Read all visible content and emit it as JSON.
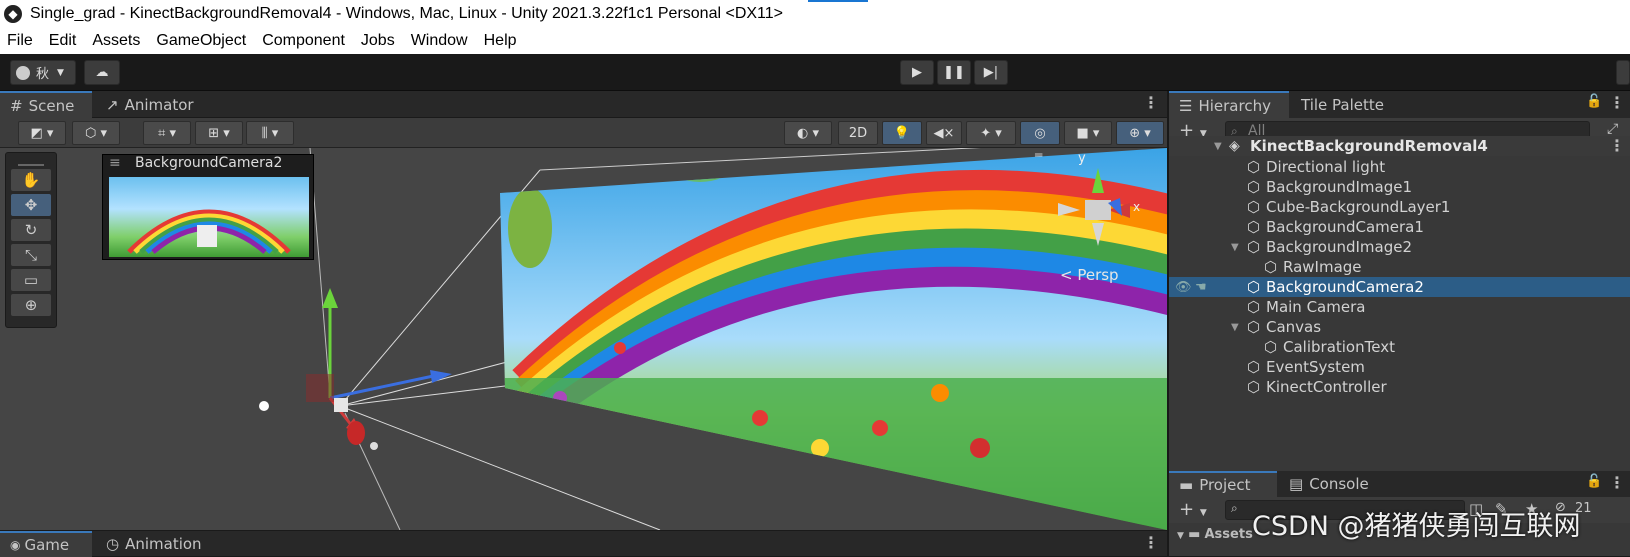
{
  "window": {
    "title": "Single_grad - KinectBackgroundRemoval4 - Windows, Mac, Linux - Unity 2021.3.22f1c1 Personal <DX11>"
  },
  "menu": [
    "File",
    "Edit",
    "Assets",
    "GameObject",
    "Component",
    "Jobs",
    "Window",
    "Help"
  ],
  "toolbar": {
    "account_label": "秋",
    "play_icon": "play-icon",
    "pause_icon": "pause-icon",
    "step_icon": "step-icon"
  },
  "scene_tabs": {
    "scene": "Scene",
    "animator": "Animator"
  },
  "scene_toolbar": {
    "mode_2d": "2D"
  },
  "viewport": {
    "camera_preview_title": "BackgroundCamera2",
    "gizmo_y": "y",
    "gizmo_x": "x",
    "persp_label": "< Persp"
  },
  "bottom_tabs": {
    "game": "Game",
    "animation": "Animation"
  },
  "hierarchy": {
    "tab_hierarchy": "Hierarchy",
    "tab_tile_palette": "Tile Palette",
    "search_placeholder": "All",
    "scene_name": "KinectBackgroundRemoval4",
    "items": [
      {
        "label": "Directional light",
        "depth": 1
      },
      {
        "label": "BackgroundImage1",
        "depth": 1
      },
      {
        "label": "Cube-BackgroundLayer1",
        "depth": 1
      },
      {
        "label": "BackgroundCamera1",
        "depth": 1
      },
      {
        "label": "BackgroundImage2",
        "depth": 1,
        "expanded": true
      },
      {
        "label": "RawImage",
        "depth": 2
      },
      {
        "label": "BackgroundCamera2",
        "depth": 1,
        "selected": true
      },
      {
        "label": "Main Camera",
        "depth": 1
      },
      {
        "label": "Canvas",
        "depth": 1,
        "expanded": true
      },
      {
        "label": "CalibrationText",
        "depth": 2
      },
      {
        "label": "EventSystem",
        "depth": 1
      },
      {
        "label": "KinectController",
        "depth": 1
      }
    ]
  },
  "project": {
    "tab_project": "Project",
    "tab_console": "Console",
    "count": "21",
    "assets_label": "Assets"
  },
  "watermark": "CSDN @猪猪侠勇闯互联网",
  "colors": {
    "selection": "#2c5d87",
    "accent": "#3a79bb"
  }
}
